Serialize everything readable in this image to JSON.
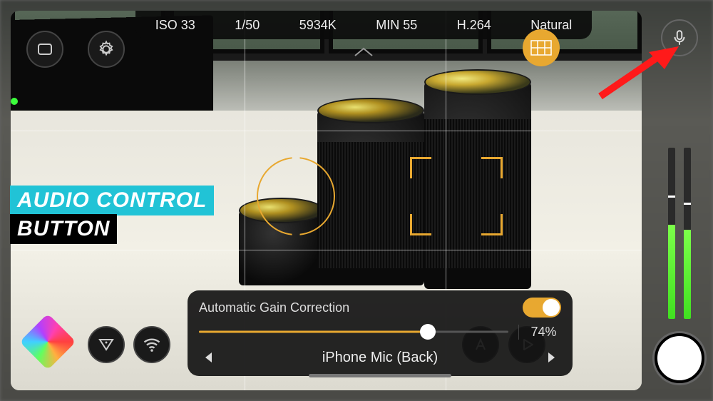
{
  "topbar": {
    "iso": "ISO 33",
    "shutter": "1/50",
    "wb": "5934K",
    "focus": "MIN 55",
    "codec": "H.264",
    "look": "Natural"
  },
  "audio_panel": {
    "agc_label": "Automatic Gain Correction",
    "agc_on": true,
    "gain_percent": 74,
    "gain_display": "74%",
    "source": "iPhone Mic (Back)"
  },
  "meters": {
    "left_level": 55,
    "right_level": 52,
    "left_peak": 28,
    "right_peak": 32
  },
  "annotation": {
    "line1": "AUDIO CONTROL",
    "line2": "BUTTON"
  },
  "colors": {
    "accent": "#e8a830",
    "meter_green": "#5cff3c",
    "anno_cyan": "#21c3d6",
    "anno_red": "#ff1a1a"
  }
}
